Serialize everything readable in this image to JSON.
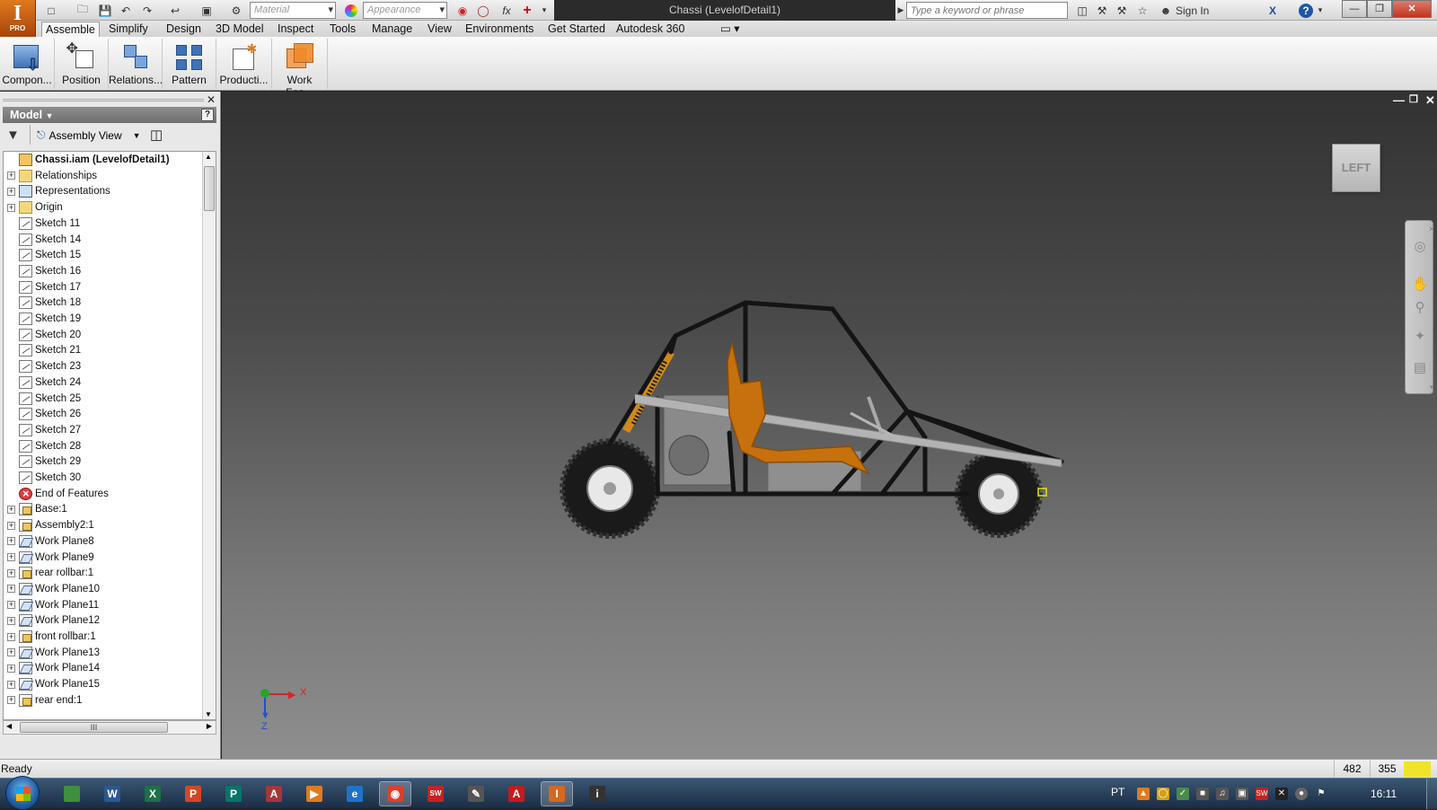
{
  "app": {
    "logo_letter": "I",
    "logo_edition": "PRO"
  },
  "title_bar": {
    "material_placeholder": "Material",
    "appearance_placeholder": "Appearance",
    "fx_symbol": "fx",
    "document_title": "Chassi (LevelofDetail1)",
    "search_placeholder": "Type a keyword or phrase",
    "sign_in": "Sign In",
    "help": "?"
  },
  "menu": {
    "tabs": [
      {
        "label": "Assemble",
        "active": true
      },
      {
        "label": "Simplify"
      },
      {
        "label": "Design"
      },
      {
        "label": "3D Model"
      },
      {
        "label": "Inspect"
      },
      {
        "label": "Tools"
      },
      {
        "label": "Manage"
      },
      {
        "label": "View"
      },
      {
        "label": "Environments"
      },
      {
        "label": "Get Started"
      },
      {
        "label": "Autodesk 360"
      }
    ]
  },
  "ribbon": {
    "buttons": [
      {
        "label": "Compon..."
      },
      {
        "label": "Position"
      },
      {
        "label": "Relations..."
      },
      {
        "label": "Pattern"
      },
      {
        "label": "Producti..."
      },
      {
        "label": "Work Fea..."
      }
    ]
  },
  "browser": {
    "header": "Model",
    "view_dropdown": "Assembly View",
    "tree": [
      {
        "label": "Chassi.iam (LevelofDetail1)",
        "icon": "root-assembly-icon",
        "bold": true,
        "expander": "none"
      },
      {
        "label": "Relationships",
        "icon": "folder-icon",
        "expander": "+"
      },
      {
        "label": "Representations",
        "icon": "representations-icon",
        "expander": "+"
      },
      {
        "label": "Origin",
        "icon": "folder-icon",
        "expander": "+"
      },
      {
        "label": "Sketch 11",
        "icon": "sketch-icon"
      },
      {
        "label": "Sketch 14",
        "icon": "sketch-icon"
      },
      {
        "label": "Sketch 15",
        "icon": "sketch-icon"
      },
      {
        "label": "Sketch 16",
        "icon": "sketch-icon"
      },
      {
        "label": "Sketch 17",
        "icon": "sketch-icon"
      },
      {
        "label": "Sketch 18",
        "icon": "sketch-icon"
      },
      {
        "label": "Sketch 19",
        "icon": "sketch-icon"
      },
      {
        "label": "Sketch 20",
        "icon": "sketch-icon"
      },
      {
        "label": "Sketch 21",
        "icon": "sketch-icon"
      },
      {
        "label": "Sketch 23",
        "icon": "sketch-icon"
      },
      {
        "label": "Sketch 24",
        "icon": "sketch-icon"
      },
      {
        "label": "Sketch 25",
        "icon": "sketch-icon"
      },
      {
        "label": "Sketch 26",
        "icon": "sketch-icon"
      },
      {
        "label": "Sketch 27",
        "icon": "sketch-icon"
      },
      {
        "label": "Sketch 28",
        "icon": "sketch-icon"
      },
      {
        "label": "Sketch 29",
        "icon": "sketch-icon"
      },
      {
        "label": "Sketch 30",
        "icon": "sketch-icon"
      },
      {
        "label": "End of Features",
        "icon": "end-of-features-icon"
      },
      {
        "label": "Base:1",
        "icon": "part-icon",
        "expander": "+"
      },
      {
        "label": "Assembly2:1",
        "icon": "part-icon",
        "expander": "+"
      },
      {
        "label": "Work Plane8",
        "icon": "work-plane-icon",
        "expander": "+"
      },
      {
        "label": "Work Plane9",
        "icon": "work-plane-icon",
        "expander": "+"
      },
      {
        "label": "rear rollbar:1",
        "icon": "part-icon",
        "expander": "+"
      },
      {
        "label": "Work Plane10",
        "icon": "work-plane-icon",
        "expander": "+"
      },
      {
        "label": "Work Plane11",
        "icon": "work-plane-icon",
        "expander": "+"
      },
      {
        "label": "Work Plane12",
        "icon": "work-plane-icon",
        "expander": "+"
      },
      {
        "label": "front rollbar:1",
        "icon": "part-icon",
        "expander": "+"
      },
      {
        "label": "Work Plane13",
        "icon": "work-plane-icon",
        "expander": "+"
      },
      {
        "label": "Work Plane14",
        "icon": "work-plane-icon",
        "expander": "+"
      },
      {
        "label": "Work Plane15",
        "icon": "work-plane-icon",
        "expander": "+"
      },
      {
        "label": "rear end:1",
        "icon": "part-icon",
        "expander": "+"
      }
    ],
    "hscroll_label": "III"
  },
  "viewport": {
    "viewcube_label": "LEFT",
    "triad": {
      "x_label": "X",
      "z_label": "Z"
    }
  },
  "status": {
    "text": "Ready",
    "x": "482",
    "y": "355"
  },
  "taskbar": {
    "apps": [
      {
        "name": "explorer",
        "letter": "",
        "color": "#3f8f3f"
      },
      {
        "name": "word",
        "letter": "W",
        "color": "#2b5797"
      },
      {
        "name": "excel",
        "letter": "X",
        "color": "#1e7145"
      },
      {
        "name": "powerpoint",
        "letter": "P",
        "color": "#d24726"
      },
      {
        "name": "publisher",
        "letter": "P",
        "color": "#077568"
      },
      {
        "name": "access",
        "letter": "A",
        "color": "#a4373a"
      },
      {
        "name": "media",
        "letter": "▶",
        "color": "#e07a1f"
      },
      {
        "name": "internet-explorer",
        "letter": "e",
        "color": "#1e73c9"
      },
      {
        "name": "chrome",
        "letter": "◉",
        "color": "#d9412c",
        "active": true
      },
      {
        "name": "solidworks",
        "letter": "SW",
        "color": "#c72222"
      },
      {
        "name": "tool",
        "letter": "✎",
        "color": "#555"
      },
      {
        "name": "acrobat",
        "letter": "A",
        "color": "#c41c1c"
      },
      {
        "name": "inventor",
        "letter": "I",
        "color": "#d2691e",
        "active": true
      },
      {
        "name": "info",
        "letter": "i",
        "color": "#333"
      }
    ],
    "language": "PT",
    "clock": "16:11"
  },
  "colors": {
    "accent": "#e07a1f",
    "seat": "#c7700e",
    "frame": "#141414",
    "rail": "#a9a9a9"
  }
}
